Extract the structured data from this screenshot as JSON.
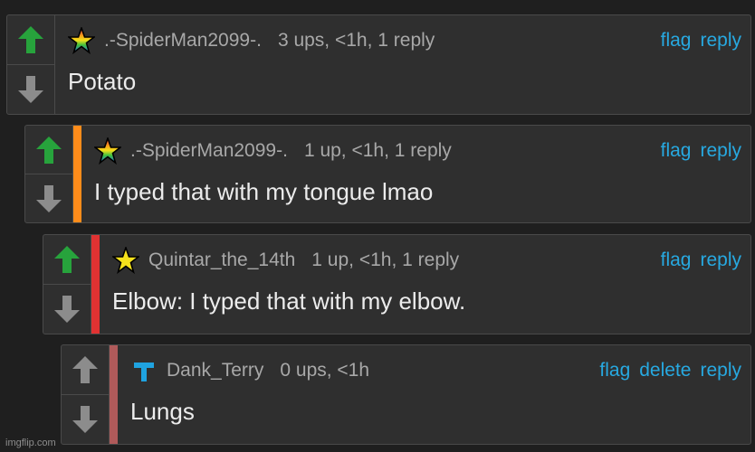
{
  "colors": {
    "up_active": "#27a33c",
    "up_inactive": "#8c8c8c",
    "down": "#8c8c8c",
    "link": "#27a9e1",
    "depth1": "#ff8c1a",
    "depth2": "#e03232",
    "depth3": "#b05a5a"
  },
  "comments": [
    {
      "rank_icon": "rainbow-star-icon",
      "user": ".-SpiderMan2099-.",
      "meta": "3 ups, <1h, 1 reply",
      "actions": [
        "flag",
        "reply"
      ],
      "text": "Potato"
    },
    {
      "rank_icon": "rainbow-star-icon",
      "user": ".-SpiderMan2099-.",
      "meta": "1 up, <1h, 1 reply",
      "actions": [
        "flag",
        "reply"
      ],
      "text": "I typed that with my tongue lmao"
    },
    {
      "rank_icon": "yellow-star-icon",
      "user": "Quintar_the_14th",
      "meta": "1 up, <1h, 1 reply",
      "actions": [
        "flag",
        "reply"
      ],
      "text": "Elbow: I typed that with my elbow."
    },
    {
      "rank_icon": "blue-t-icon",
      "user": "Dank_Terry",
      "meta": "0 ups, <1h",
      "actions": [
        "flag",
        "delete",
        "reply"
      ],
      "text": "Lungs"
    }
  ],
  "watermark": "imgflip.com"
}
